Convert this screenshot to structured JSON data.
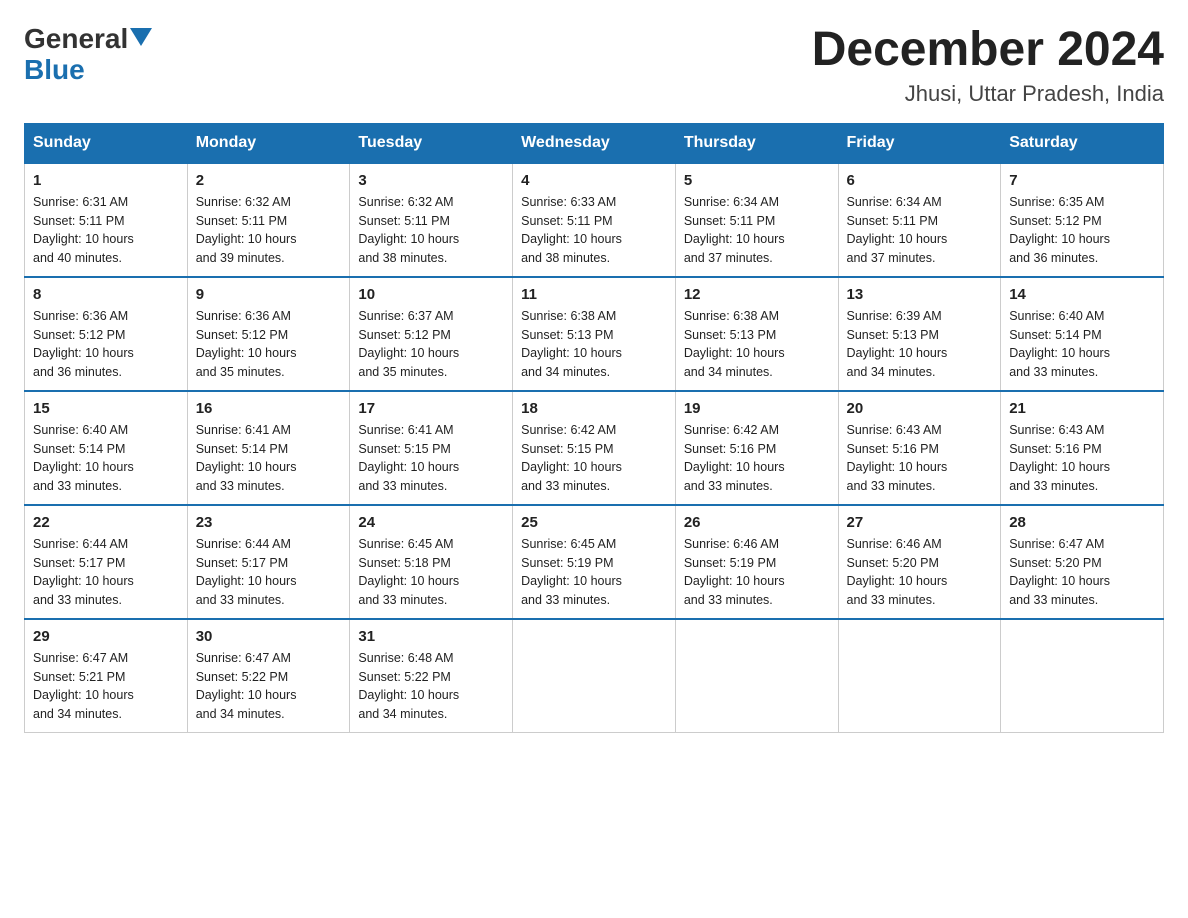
{
  "logo": {
    "general": "General",
    "blue": "Blue"
  },
  "title": "December 2024",
  "subtitle": "Jhusi, Uttar Pradesh, India",
  "days_of_week": [
    "Sunday",
    "Monday",
    "Tuesday",
    "Wednesday",
    "Thursday",
    "Friday",
    "Saturday"
  ],
  "weeks": [
    [
      {
        "day": "1",
        "sunrise": "6:31 AM",
        "sunset": "5:11 PM",
        "daylight": "10 hours and 40 minutes."
      },
      {
        "day": "2",
        "sunrise": "6:32 AM",
        "sunset": "5:11 PM",
        "daylight": "10 hours and 39 minutes."
      },
      {
        "day": "3",
        "sunrise": "6:32 AM",
        "sunset": "5:11 PM",
        "daylight": "10 hours and 38 minutes."
      },
      {
        "day": "4",
        "sunrise": "6:33 AM",
        "sunset": "5:11 PM",
        "daylight": "10 hours and 38 minutes."
      },
      {
        "day": "5",
        "sunrise": "6:34 AM",
        "sunset": "5:11 PM",
        "daylight": "10 hours and 37 minutes."
      },
      {
        "day": "6",
        "sunrise": "6:34 AM",
        "sunset": "5:11 PM",
        "daylight": "10 hours and 37 minutes."
      },
      {
        "day": "7",
        "sunrise": "6:35 AM",
        "sunset": "5:12 PM",
        "daylight": "10 hours and 36 minutes."
      }
    ],
    [
      {
        "day": "8",
        "sunrise": "6:36 AM",
        "sunset": "5:12 PM",
        "daylight": "10 hours and 36 minutes."
      },
      {
        "day": "9",
        "sunrise": "6:36 AM",
        "sunset": "5:12 PM",
        "daylight": "10 hours and 35 minutes."
      },
      {
        "day": "10",
        "sunrise": "6:37 AM",
        "sunset": "5:12 PM",
        "daylight": "10 hours and 35 minutes."
      },
      {
        "day": "11",
        "sunrise": "6:38 AM",
        "sunset": "5:13 PM",
        "daylight": "10 hours and 34 minutes."
      },
      {
        "day": "12",
        "sunrise": "6:38 AM",
        "sunset": "5:13 PM",
        "daylight": "10 hours and 34 minutes."
      },
      {
        "day": "13",
        "sunrise": "6:39 AM",
        "sunset": "5:13 PM",
        "daylight": "10 hours and 34 minutes."
      },
      {
        "day": "14",
        "sunrise": "6:40 AM",
        "sunset": "5:14 PM",
        "daylight": "10 hours and 33 minutes."
      }
    ],
    [
      {
        "day": "15",
        "sunrise": "6:40 AM",
        "sunset": "5:14 PM",
        "daylight": "10 hours and 33 minutes."
      },
      {
        "day": "16",
        "sunrise": "6:41 AM",
        "sunset": "5:14 PM",
        "daylight": "10 hours and 33 minutes."
      },
      {
        "day": "17",
        "sunrise": "6:41 AM",
        "sunset": "5:15 PM",
        "daylight": "10 hours and 33 minutes."
      },
      {
        "day": "18",
        "sunrise": "6:42 AM",
        "sunset": "5:15 PM",
        "daylight": "10 hours and 33 minutes."
      },
      {
        "day": "19",
        "sunrise": "6:42 AM",
        "sunset": "5:16 PM",
        "daylight": "10 hours and 33 minutes."
      },
      {
        "day": "20",
        "sunrise": "6:43 AM",
        "sunset": "5:16 PM",
        "daylight": "10 hours and 33 minutes."
      },
      {
        "day": "21",
        "sunrise": "6:43 AM",
        "sunset": "5:16 PM",
        "daylight": "10 hours and 33 minutes."
      }
    ],
    [
      {
        "day": "22",
        "sunrise": "6:44 AM",
        "sunset": "5:17 PM",
        "daylight": "10 hours and 33 minutes."
      },
      {
        "day": "23",
        "sunrise": "6:44 AM",
        "sunset": "5:17 PM",
        "daylight": "10 hours and 33 minutes."
      },
      {
        "day": "24",
        "sunrise": "6:45 AM",
        "sunset": "5:18 PM",
        "daylight": "10 hours and 33 minutes."
      },
      {
        "day": "25",
        "sunrise": "6:45 AM",
        "sunset": "5:19 PM",
        "daylight": "10 hours and 33 minutes."
      },
      {
        "day": "26",
        "sunrise": "6:46 AM",
        "sunset": "5:19 PM",
        "daylight": "10 hours and 33 minutes."
      },
      {
        "day": "27",
        "sunrise": "6:46 AM",
        "sunset": "5:20 PM",
        "daylight": "10 hours and 33 minutes."
      },
      {
        "day": "28",
        "sunrise": "6:47 AM",
        "sunset": "5:20 PM",
        "daylight": "10 hours and 33 minutes."
      }
    ],
    [
      {
        "day": "29",
        "sunrise": "6:47 AM",
        "sunset": "5:21 PM",
        "daylight": "10 hours and 34 minutes."
      },
      {
        "day": "30",
        "sunrise": "6:47 AM",
        "sunset": "5:22 PM",
        "daylight": "10 hours and 34 minutes."
      },
      {
        "day": "31",
        "sunrise": "6:48 AM",
        "sunset": "5:22 PM",
        "daylight": "10 hours and 34 minutes."
      },
      null,
      null,
      null,
      null
    ]
  ],
  "labels": {
    "sunrise": "Sunrise:",
    "sunset": "Sunset:",
    "daylight": "Daylight:"
  }
}
